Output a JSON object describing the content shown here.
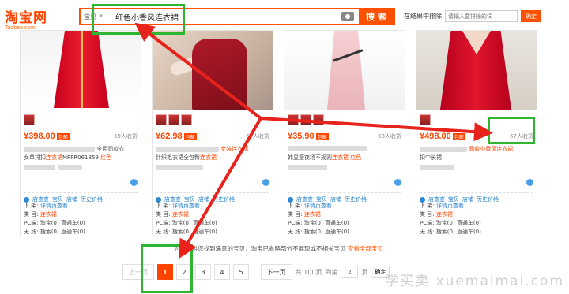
{
  "logo": {
    "main": "淘宝网",
    "sub": "Taobao.com"
  },
  "search": {
    "type_label": "宝贝",
    "query": "红色小香风连衣裙",
    "button": "搜 索"
  },
  "exclude": {
    "label": "在结果中排除",
    "placeholder": "请输入要排除的词",
    "button": "确定"
  },
  "products": [
    {
      "price": "¥398.00",
      "tag": "包邮",
      "sales": "69人收货",
      "title1": "全民同款衣",
      "title2_a": "女单排扣",
      "title2_hl": "连衣裙",
      "title2_b": "MFPR061859",
      "title2_c": "红色",
      "tools": [
        "店查查",
        "宝贝",
        "店铺",
        "历史价格"
      ],
      "shelf_label": "下 架:",
      "shelf_value": "详情页查看",
      "cat_label": "类 目:",
      "cat_value": "连衣裙",
      "pc_label": "PC端:",
      "pc_value": "淘宝(0) 直通车(0)",
      "wx_label": "无 线:",
      "wx_value": "搜索(0) 直通车(0)"
    },
    {
      "price": "¥62.98",
      "tag": "包邮",
      "sales": "68人收货",
      "title1": "女装连衣裙",
      "title2_a": "针织毛衣裙全包臀",
      "title2_hl": "连衣裙",
      "title2_b": "",
      "title2_c": "",
      "tools": [
        "店查查",
        "宝贝",
        "店铺",
        "历史价格"
      ],
      "shelf_label": "下 架:",
      "shelf_value": "详情页查看",
      "cat_label": "类 目:",
      "cat_value": "连衣裙",
      "pc_label": "PC端:",
      "pc_value": "淘宝(0) 直通车(0)",
      "wx_label": "无 线:",
      "wx_value": "搜索(0) 直通车(0)"
    },
    {
      "price": "¥35.90",
      "tag": "包邮",
      "sales": "68人收货",
      "title1": "",
      "title2_a": "韩显瘦夜场不规则",
      "title2_hl": "连衣裙",
      "title2_b": "",
      "title2_c": "红色",
      "tools": [
        "店查查",
        "宝贝",
        "店铺",
        "历史价格"
      ],
      "shelf_label": "下 架:",
      "shelf_value": "详情页查看",
      "cat_label": "类 目:",
      "cat_value": "连衣裙",
      "pc_label": "PC端:",
      "pc_value": "淘宝(0) 直通车(0)",
      "wx_label": "无 线:",
      "wx_value": "搜索(0) 直通车(0)"
    },
    {
      "price": "¥498.00",
      "tag": "包邮",
      "sales": "67人收货",
      "title1": "同款小香风连衣裙",
      "title2_a": "扣中长裙",
      "title2_hl": "",
      "title2_b": "",
      "title2_c": "",
      "tools": [
        "店查查",
        "宝贝",
        "店铺",
        "历史价格"
      ],
      "shelf_label": "下 架:",
      "shelf_value": "详情页查看",
      "cat_label": "类 目:",
      "cat_value": "连衣裙",
      "pc_label": "PC端:",
      "pc_value": "淘宝(0) 直通车(0)",
      "wx_label": "无 线:",
      "wx_value": "搜索(0) 直通车(0)"
    }
  ],
  "notice": {
    "text": "为了提供您找到满意的宝贝，淘宝已省略部分不展现或不相关宝贝",
    "link": "查看全部宝贝"
  },
  "pager": {
    "prev": "上一页",
    "pages": [
      "1",
      "2",
      "3",
      "4",
      "5"
    ],
    "current": "1",
    "ellipsis": "...",
    "next": "下一页",
    "total": "共 100页",
    "goto": "到第",
    "goto_value": "2",
    "page_unit": "页",
    "ok": "确定"
  },
  "watermark": "学买卖 xuemaimai.com",
  "colors": {
    "accent": "#ff5000",
    "price": "#ff4400",
    "annotation_box": "#2fb52f",
    "annotation_arrow": "#e8231c"
  }
}
